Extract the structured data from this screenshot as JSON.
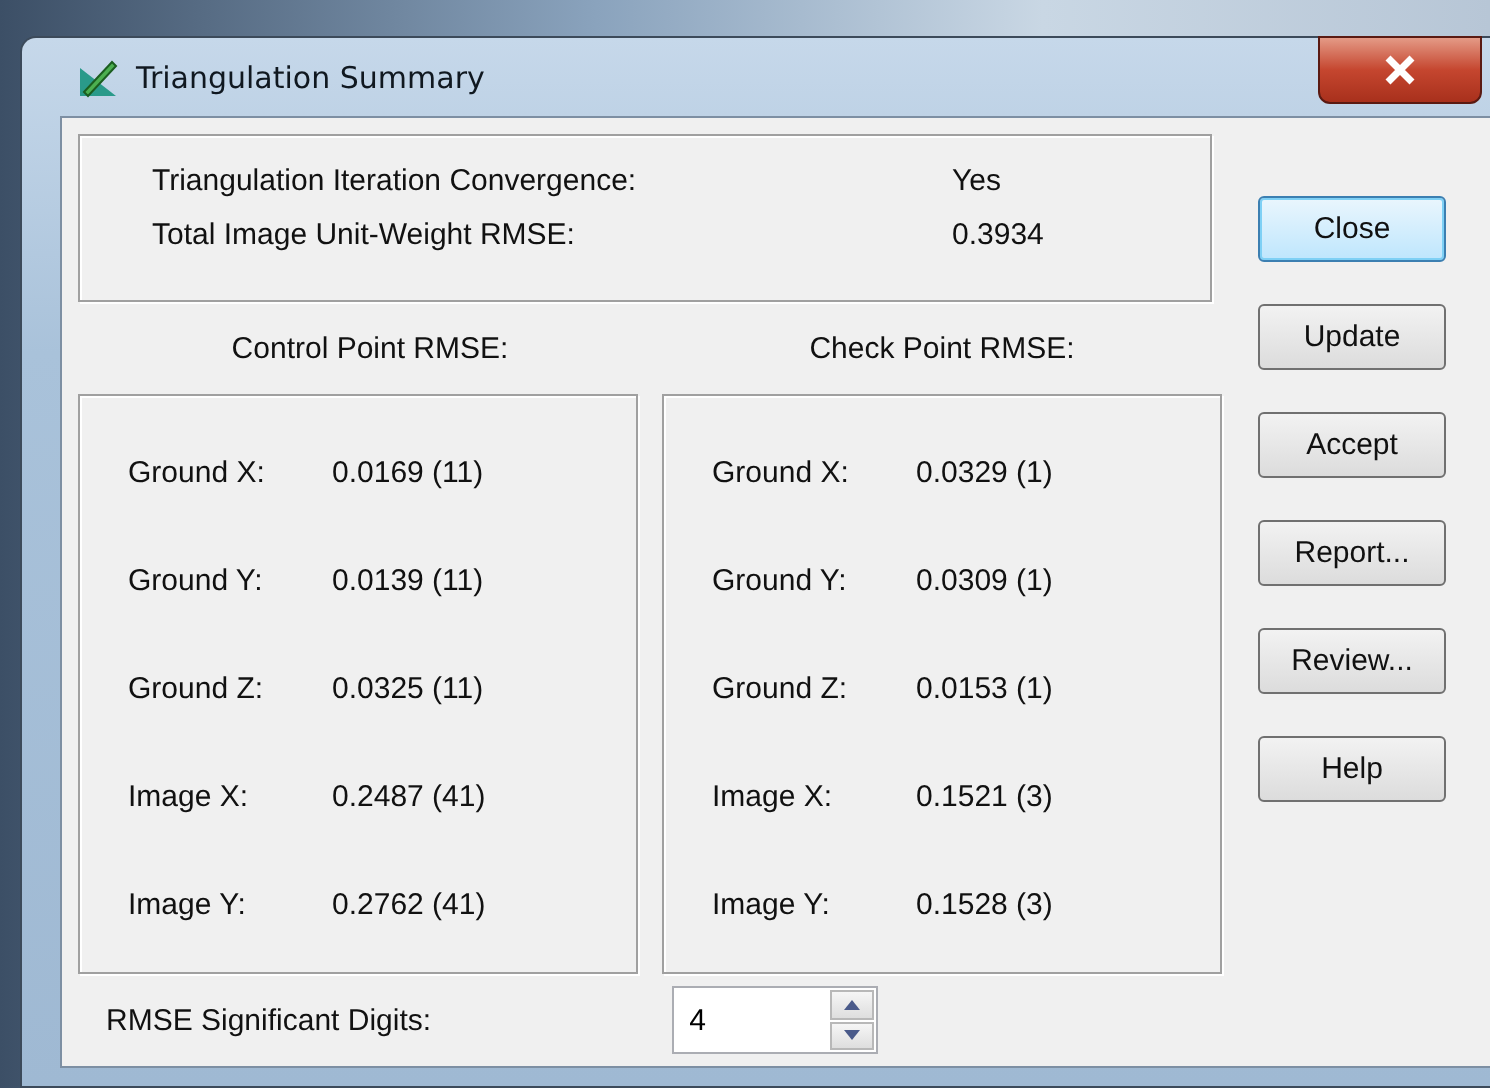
{
  "window": {
    "title": "Triangulation Summary"
  },
  "summary": [
    {
      "label": "Triangulation Iteration Convergence:",
      "value": "Yes"
    },
    {
      "label": "Total Image Unit-Weight RMSE:",
      "value": "0.3934"
    }
  ],
  "panels": [
    {
      "heading": "Control Point RMSE:",
      "rows": [
        {
          "label": "Ground X:",
          "value": "0.0169 (11)"
        },
        {
          "label": "Ground Y:",
          "value": "0.0139 (11)"
        },
        {
          "label": "Ground Z:",
          "value": "0.0325 (11)"
        },
        {
          "label": "Image X:",
          "value": "0.2487 (41)"
        },
        {
          "label": "Image Y:",
          "value": "0.2762 (41)"
        }
      ]
    },
    {
      "heading": "Check Point RMSE:",
      "rows": [
        {
          "label": "Ground X:",
          "value": "0.0329 (1)"
        },
        {
          "label": "Ground Y:",
          "value": "0.0309 (1)"
        },
        {
          "label": "Ground Z:",
          "value": "0.0153 (1)"
        },
        {
          "label": "Image X:",
          "value": "0.1521 (3)"
        },
        {
          "label": "Image Y:",
          "value": "0.1528 (3)"
        }
      ]
    }
  ],
  "buttons": [
    {
      "label": "Close",
      "default": true
    },
    {
      "label": "Update",
      "default": false
    },
    {
      "label": "Accept",
      "default": false
    },
    {
      "label": "Report...",
      "default": false
    },
    {
      "label": "Review...",
      "default": false
    },
    {
      "label": "Help",
      "default": false
    }
  ],
  "digits": {
    "label": "RMSE Significant Digits:",
    "value": "4"
  }
}
